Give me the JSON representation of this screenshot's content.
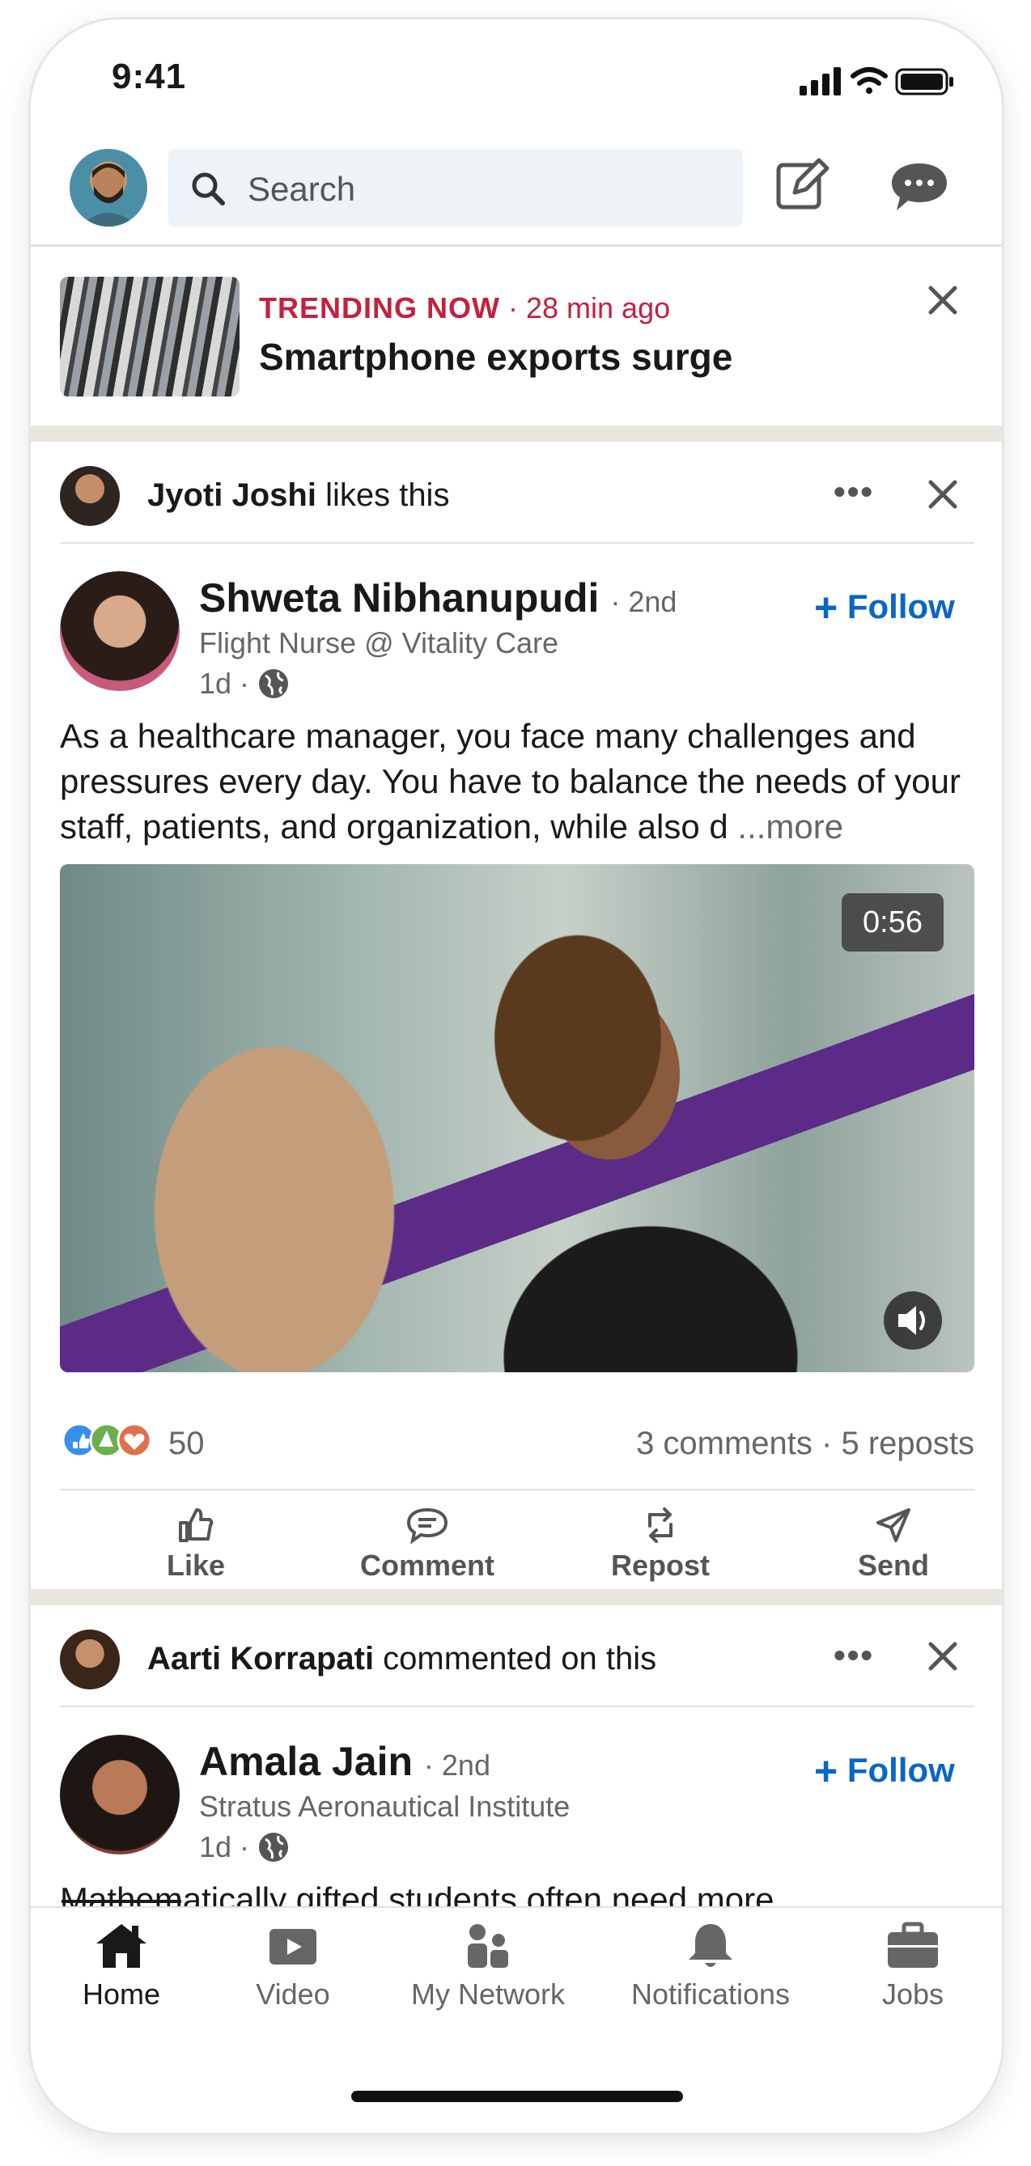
{
  "status_bar": {
    "time": "9:41"
  },
  "search": {
    "placeholder": "Search"
  },
  "trending": {
    "tag": "TRENDING NOW",
    "age": "· 28 min ago",
    "title": "Smartphone exports surge"
  },
  "post1": {
    "activity_actor": "Jyoti Joshi",
    "activity_text": " likes this",
    "author": "Shweta Nibhanupudi",
    "degree": "· 2nd",
    "headline": "Flight Nurse @ Vitality Care",
    "age": "1d ·",
    "follow_label": "Follow",
    "text": "As a healthcare manager, you face many challenges and pressures every day. You have to balance the needs of your staff, patients, and organization, while also d ",
    "more": "...more",
    "video_duration": "0:56",
    "reaction_count": "50",
    "stats": "3 comments · 5 reposts"
  },
  "actions": {
    "like": "Like",
    "comment": "Comment",
    "repost": "Repost",
    "send": "Send"
  },
  "post2": {
    "activity_actor": "Aarti Korrapati",
    "activity_text": " commented on this",
    "author": "Amala Jain",
    "degree": "· 2nd",
    "headline": "Stratus Aeronautical Institute",
    "age": "1d ·",
    "follow_label": "Follow",
    "text": "Mathematically gifted students often need more"
  },
  "nav": {
    "home": "Home",
    "video": "Video",
    "network": "My Network",
    "notifications": "Notifications",
    "jobs": "Jobs"
  },
  "colors": {
    "brand_blue": "#0a66c2",
    "trending_red": "#c3213f",
    "divider": "#e8e6df"
  }
}
